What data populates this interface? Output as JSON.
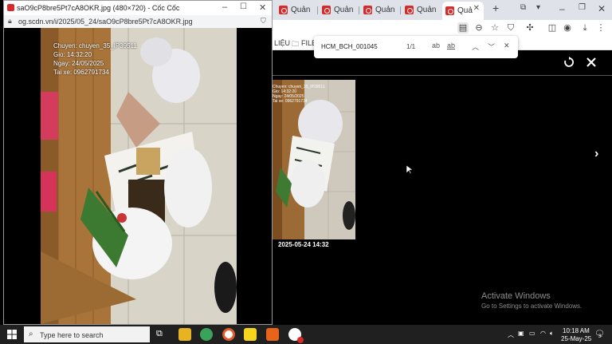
{
  "popup": {
    "title": "saO9cP8bre5Pt7cA8OKR.jpg (480×720) - Cốc Cốc",
    "url": "og.scdn.vn/i/2025/05_24/saO9cP8bre5Pt7cA8OKR.jpg",
    "overlay": {
      "line1": "Chuyen: chuyen_35_IP39511",
      "line2": "Gio: 14:32:20",
      "line3": "Ngay: 24/05/2025",
      "line4": "Tai xe: 0962791734"
    }
  },
  "browser": {
    "tabs": [
      {
        "label": "Quản lý"
      },
      {
        "label": "Quản Lý"
      },
      {
        "label": "Quản Lý"
      },
      {
        "label": "Quản Lý"
      },
      {
        "label": "Quả"
      }
    ],
    "bookmarks": {
      "item1": "LIỆU",
      "item2": "FILE C"
    }
  },
  "findbar": {
    "query": "HCM_BCH_001045",
    "count": "1/1",
    "match_case": "ab",
    "whole_word": "ab"
  },
  "viewer": {
    "thumb_overlay": {
      "line1": "Chuyen: chuyen_35_IP39511",
      "line2": "Gio: 14:32:20",
      "line3": "Ngay: 24/05/2025",
      "line4": "Tai xe: 0962791734"
    },
    "caption": "2025-05-24 14:32",
    "next_glyph": "›"
  },
  "watermark": {
    "title": "Activate Windows",
    "subtitle": "Go to Settings to activate Windows."
  },
  "taskbar": {
    "search_placeholder": "Type here to search",
    "time": "10:18 AM",
    "date": "25-May-25",
    "notification_count": "3"
  },
  "colors": {
    "accent": "#d62b2b",
    "taskbar": "#202020",
    "bag_blue": "#2a4a8a"
  }
}
